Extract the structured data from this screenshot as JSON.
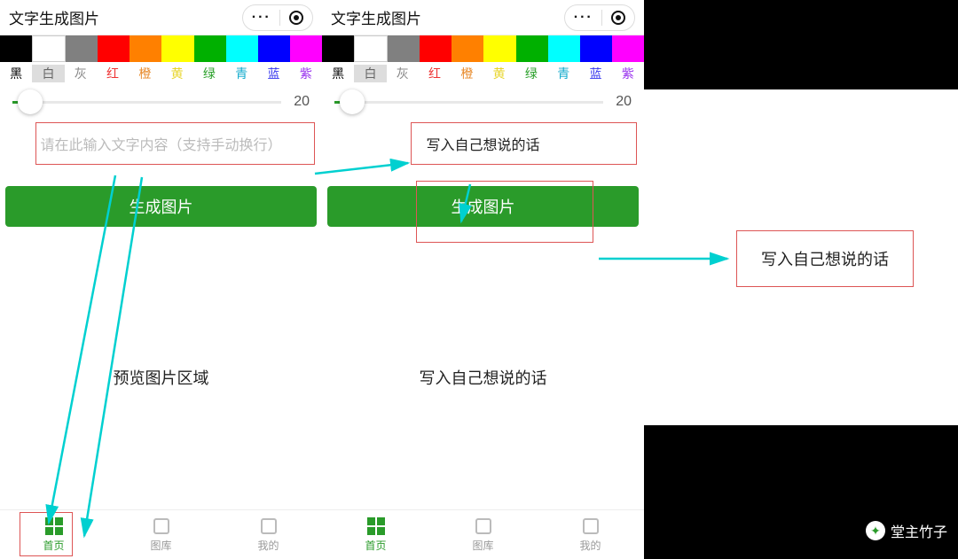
{
  "header": {
    "title": "文字生成图片"
  },
  "colors": {
    "swatches": [
      "#000000",
      "#ffffff",
      "#808080",
      "#ff0000",
      "#ff8000",
      "#ffff00",
      "#00b000",
      "#00ffff",
      "#0000ff",
      "#ff00ff"
    ],
    "labels": [
      {
        "t": "黑",
        "c": "#000"
      },
      {
        "t": "白",
        "c": "#666"
      },
      {
        "t": "灰",
        "c": "#888"
      },
      {
        "t": "红",
        "c": "#e33"
      },
      {
        "t": "橙",
        "c": "#e88a2a"
      },
      {
        "t": "黄",
        "c": "#e8d52a"
      },
      {
        "t": "绿",
        "c": "#2aa02a"
      },
      {
        "t": "青",
        "c": "#1ac"
      },
      {
        "t": "蓝",
        "c": "#33e"
      },
      {
        "t": "紫",
        "c": "#93e"
      }
    ],
    "selected_index": 1
  },
  "slider": {
    "value": "20",
    "percent": 5
  },
  "panel1": {
    "input_placeholder": "请在此输入文字内容（支持手动换行）",
    "generate": "生成图片",
    "preview_label": "预览图片区域"
  },
  "panel2": {
    "input_text": "写入自己想说的话",
    "generate": "生成图片",
    "preview_label": "写入自己想说的话"
  },
  "tabs": [
    {
      "label": "首页",
      "active": true
    },
    {
      "label": "图库",
      "active": false
    },
    {
      "label": "我的",
      "active": false
    }
  ],
  "right_desc": "写入自己想说的话",
  "watermark": "堂主竹子"
}
